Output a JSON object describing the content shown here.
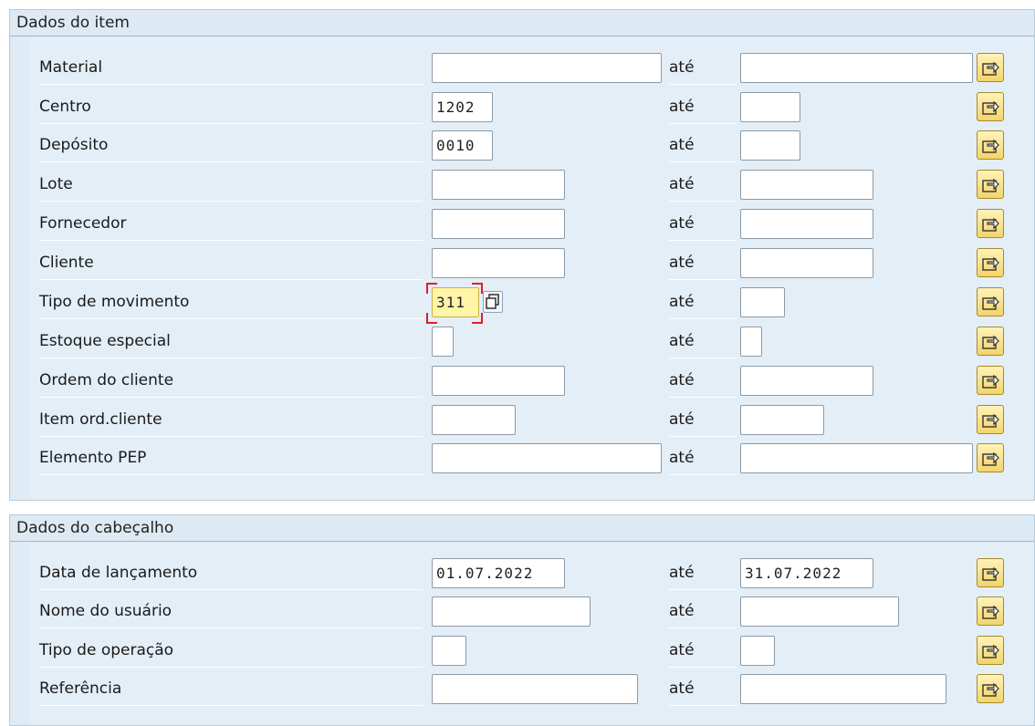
{
  "item_section": {
    "title": "Dados do item",
    "rows": [
      {
        "label": "Material",
        "from": "",
        "to": ""
      },
      {
        "label": "Centro",
        "from": "1202",
        "to": ""
      },
      {
        "label": "Depósito",
        "from": "0010",
        "to": ""
      },
      {
        "label": "Lote",
        "from": "",
        "to": ""
      },
      {
        "label": "Fornecedor",
        "from": "",
        "to": ""
      },
      {
        "label": "Cliente",
        "from": "",
        "to": ""
      },
      {
        "label": "Tipo de movimento",
        "from": "311",
        "to": ""
      },
      {
        "label": "Estoque especial",
        "from": "",
        "to": ""
      },
      {
        "label": "Ordem do cliente",
        "from": "",
        "to": ""
      },
      {
        "label": "Item ord.cliente",
        "from": "",
        "to": ""
      },
      {
        "label": "Elemento PEP",
        "from": "",
        "to": ""
      }
    ]
  },
  "header_section": {
    "title": "Dados do cabeçalho",
    "rows": [
      {
        "label": "Data de lançamento",
        "from": "01.07.2022",
        "to": "31.07.2022"
      },
      {
        "label": "Nome do usuário",
        "from": "",
        "to": ""
      },
      {
        "label": "Tipo de operação",
        "from": "",
        "to": ""
      },
      {
        "label": "Referência",
        "from": "",
        "to": ""
      }
    ]
  },
  "range_label": "até",
  "icons": {
    "multiple_selection": "multiple-selection-arrow-icon",
    "copy": "copy-icon"
  },
  "colors": {
    "panel_bg": "#e4eef7",
    "header_bg": "#dde9f3",
    "focused_field": "#fff4a8",
    "button_yellow": "#f3d56a"
  }
}
